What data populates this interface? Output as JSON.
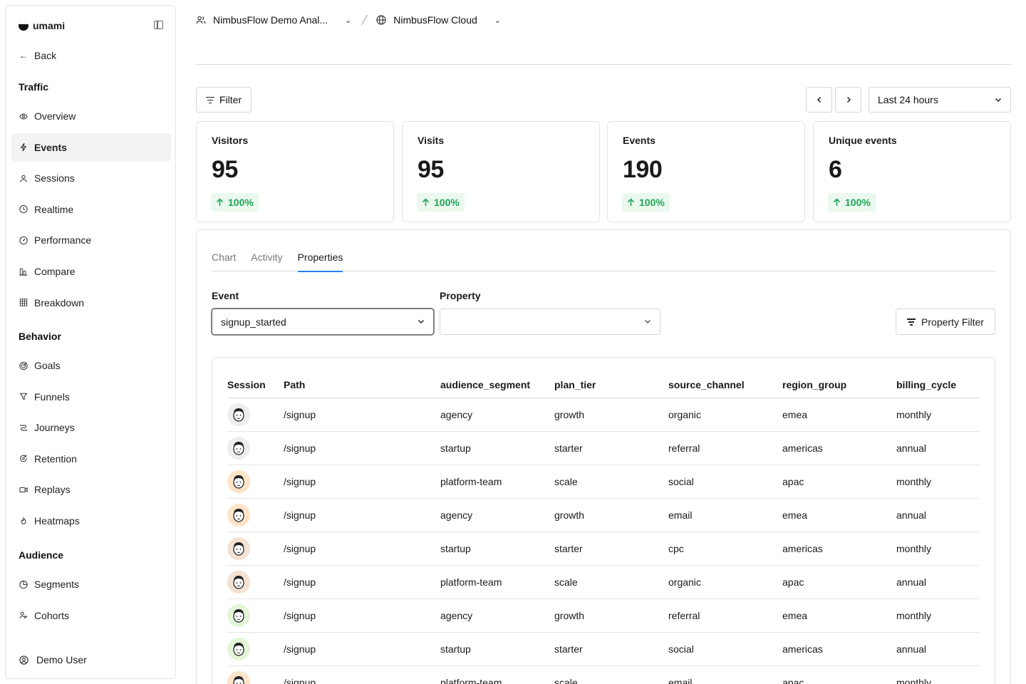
{
  "sidebar": {
    "brand": "umami",
    "back": "Back",
    "sections": {
      "traffic": "Traffic",
      "behavior": "Behavior",
      "audience": "Audience"
    },
    "traffic_items": [
      {
        "label": "Overview",
        "icon": "eye-icon"
      },
      {
        "label": "Events",
        "icon": "bolt-icon",
        "active": true
      },
      {
        "label": "Sessions",
        "icon": "user-icon"
      },
      {
        "label": "Realtime",
        "icon": "clock-icon"
      },
      {
        "label": "Performance",
        "icon": "gauge-icon"
      },
      {
        "label": "Compare",
        "icon": "compare-icon"
      },
      {
        "label": "Breakdown",
        "icon": "grid-icon"
      }
    ],
    "behavior_items": [
      {
        "label": "Goals",
        "icon": "target-icon"
      },
      {
        "label": "Funnels",
        "icon": "funnel-icon"
      },
      {
        "label": "Journeys",
        "icon": "journey-icon"
      },
      {
        "label": "Retention",
        "icon": "retention-icon"
      },
      {
        "label": "Replays",
        "icon": "video-icon"
      },
      {
        "label": "Heatmaps",
        "icon": "flame-icon"
      }
    ],
    "audience_items": [
      {
        "label": "Segments",
        "icon": "pie-icon"
      },
      {
        "label": "Cohorts",
        "icon": "users-icon"
      }
    ],
    "user": "Demo User"
  },
  "topbar": {
    "team": "NimbusFlow Demo Anal...",
    "website": "NimbusFlow Cloud"
  },
  "toolbar": {
    "filter": "Filter",
    "date_range": "Last 24 hours"
  },
  "metrics": [
    {
      "label": "Visitors",
      "value": "95",
      "change": "100%"
    },
    {
      "label": "Visits",
      "value": "95",
      "change": "100%"
    },
    {
      "label": "Events",
      "value": "190",
      "change": "100%"
    },
    {
      "label": "Unique events",
      "value": "6",
      "change": "100%"
    }
  ],
  "tabs": [
    "Chart",
    "Activity",
    "Properties"
  ],
  "active_tab": "Properties",
  "form": {
    "event_label": "Event",
    "event_value": "signup_started",
    "property_label": "Property",
    "property_value": "",
    "property_filter": "Property Filter"
  },
  "table": {
    "headers": [
      "Session",
      "Path",
      "audience_segment",
      "plan_tier",
      "source_channel",
      "region_group",
      "billing_cycle"
    ],
    "rows": [
      {
        "avatar": "#eeeeee",
        "path": "/signup",
        "segment": "agency",
        "tier": "growth",
        "channel": "organic",
        "region": "emea",
        "billing": "monthly"
      },
      {
        "avatar": "#eeeeee",
        "path": "/signup",
        "segment": "startup",
        "tier": "starter",
        "channel": "referral",
        "region": "americas",
        "billing": "annual"
      },
      {
        "avatar": "#fde3c8",
        "path": "/signup",
        "segment": "platform-team",
        "tier": "scale",
        "channel": "social",
        "region": "apac",
        "billing": "monthly"
      },
      {
        "avatar": "#fde3c8",
        "path": "/signup",
        "segment": "agency",
        "tier": "growth",
        "channel": "email",
        "region": "emea",
        "billing": "annual"
      },
      {
        "avatar": "#f3e1d2",
        "path": "/signup",
        "segment": "startup",
        "tier": "starter",
        "channel": "cpc",
        "region": "americas",
        "billing": "monthly"
      },
      {
        "avatar": "#f3e1d2",
        "path": "/signup",
        "segment": "platform-team",
        "tier": "scale",
        "channel": "organic",
        "region": "apac",
        "billing": "annual"
      },
      {
        "avatar": "#e3f6d8",
        "path": "/signup",
        "segment": "agency",
        "tier": "growth",
        "channel": "referral",
        "region": "emea",
        "billing": "monthly"
      },
      {
        "avatar": "#e3f6d8",
        "path": "/signup",
        "segment": "startup",
        "tier": "starter",
        "channel": "social",
        "region": "americas",
        "billing": "annual"
      },
      {
        "avatar": "#fde3c8",
        "path": "/signup",
        "segment": "platform-team",
        "tier": "scale",
        "channel": "email",
        "region": "apac",
        "billing": "monthly"
      }
    ]
  },
  "colors": {
    "accent": "#2680eb",
    "positive": "#23a559",
    "positive_bg": "#eaf8ee"
  }
}
